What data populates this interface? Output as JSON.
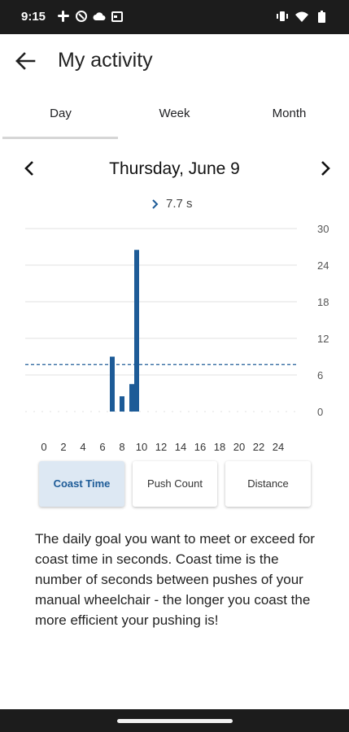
{
  "status": {
    "time": "9:15"
  },
  "header": {
    "title": "My activity"
  },
  "tabs": [
    {
      "label": "Day"
    },
    {
      "label": "Week"
    },
    {
      "label": "Month"
    }
  ],
  "date": {
    "label": "Thursday, June 9"
  },
  "selection": {
    "value": "7.7 s"
  },
  "metrics": [
    {
      "label": "Coast Time"
    },
    {
      "label": "Push Count"
    },
    {
      "label": "Distance"
    }
  ],
  "description": "The daily goal you want to meet or exceed for coast time in seconds. Coast time is the number of seconds between pushes of your manual wheelchair - the longer you coast the more efficient your pushing is!",
  "colors": {
    "bar": "#1d5b97",
    "accent": "#1d5b97",
    "grid": "#e2e2e2"
  },
  "chart_data": {
    "type": "bar",
    "xticks": [
      "0",
      "2",
      "4",
      "6",
      "8",
      "10",
      "12",
      "14",
      "16",
      "18",
      "20",
      "22",
      "24"
    ],
    "yticks": [
      "30",
      "24",
      "18",
      "12",
      "6",
      "0"
    ],
    "ylim": [
      0,
      30
    ],
    "xlim": [
      0,
      24
    ],
    "goal": 7.7,
    "bars": [
      {
        "x": 7.0,
        "y": 9.0
      },
      {
        "x": 8.0,
        "y": 2.5
      },
      {
        "x": 9.0,
        "y": 4.5
      },
      {
        "x": 9.5,
        "y": 26.5
      }
    ]
  }
}
